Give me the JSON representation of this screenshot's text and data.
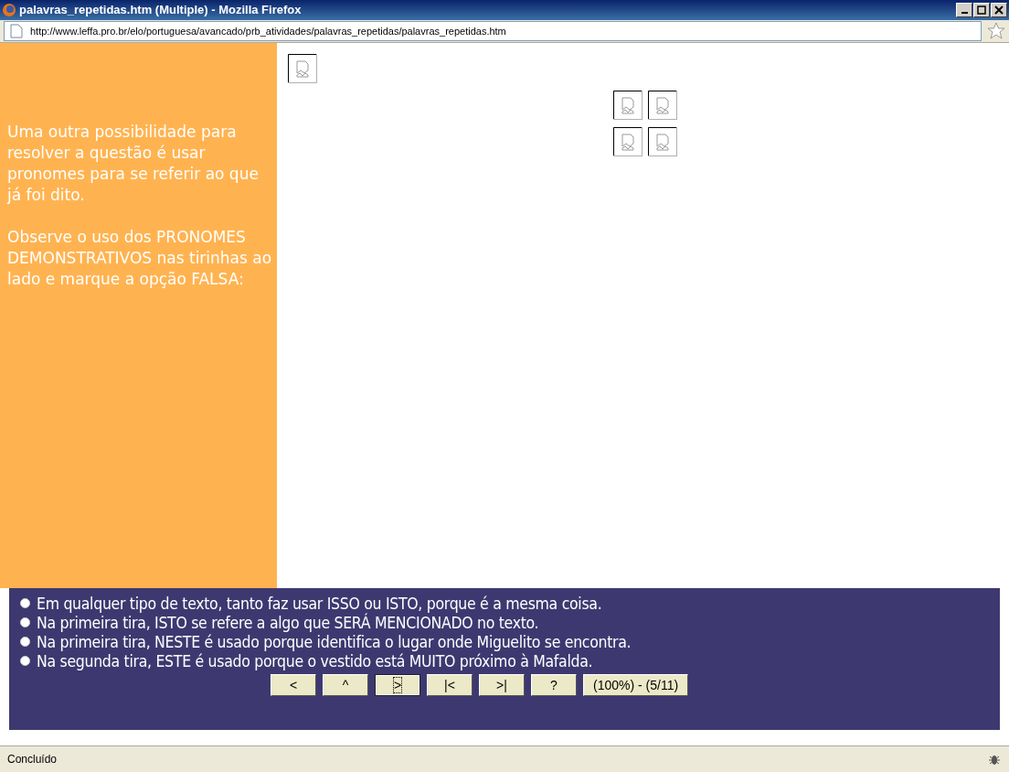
{
  "window": {
    "title": "palavras_repetidas.htm (Multiple) - Mozilla Firefox"
  },
  "address_bar": {
    "url": "http://www.leffa.pro.br/elo/portuguesa/avancado/prb_atividades/palavras_repetidas/palavras_repetidas.htm"
  },
  "sidebar": {
    "paragraphs": [
      "Uma outra possibilidade para resolver a questão é usar pronomes para se referir ao que já foi dito.",
      "Observe o uso dos PRONOMES DEMONSTRATIVOS nas tirinhas ao lado e marque a opção FALSA:"
    ]
  },
  "options": [
    {
      "label": "Em qualquer tipo de texto, tanto faz usar ISSO ou ISTO, porque é a mesma coisa.",
      "selected": false
    },
    {
      "label": "Na primeira tira, ISTO se refere a algo que SERÁ MENCIONADO no texto.",
      "selected": false
    },
    {
      "label": "Na primeira tira, NESTE é usado porque identifica o lugar onde Miguelito se encontra.",
      "selected": false
    },
    {
      "label": "Na segunda tira, ESTE é usado porque o vestido está MUITO próximo à Mafalda.",
      "selected": false
    }
  ],
  "nav_buttons": [
    {
      "label": "<",
      "focused": false
    },
    {
      "label": "^",
      "focused": false
    },
    {
      "label": ">",
      "focused": true
    },
    {
      "label": "|<",
      "focused": false
    },
    {
      "label": ">|",
      "focused": false
    },
    {
      "label": "?",
      "focused": false
    },
    {
      "label": "(100%) - (5/11)",
      "focused": false
    }
  ],
  "status_bar": {
    "text": "Concluído"
  }
}
